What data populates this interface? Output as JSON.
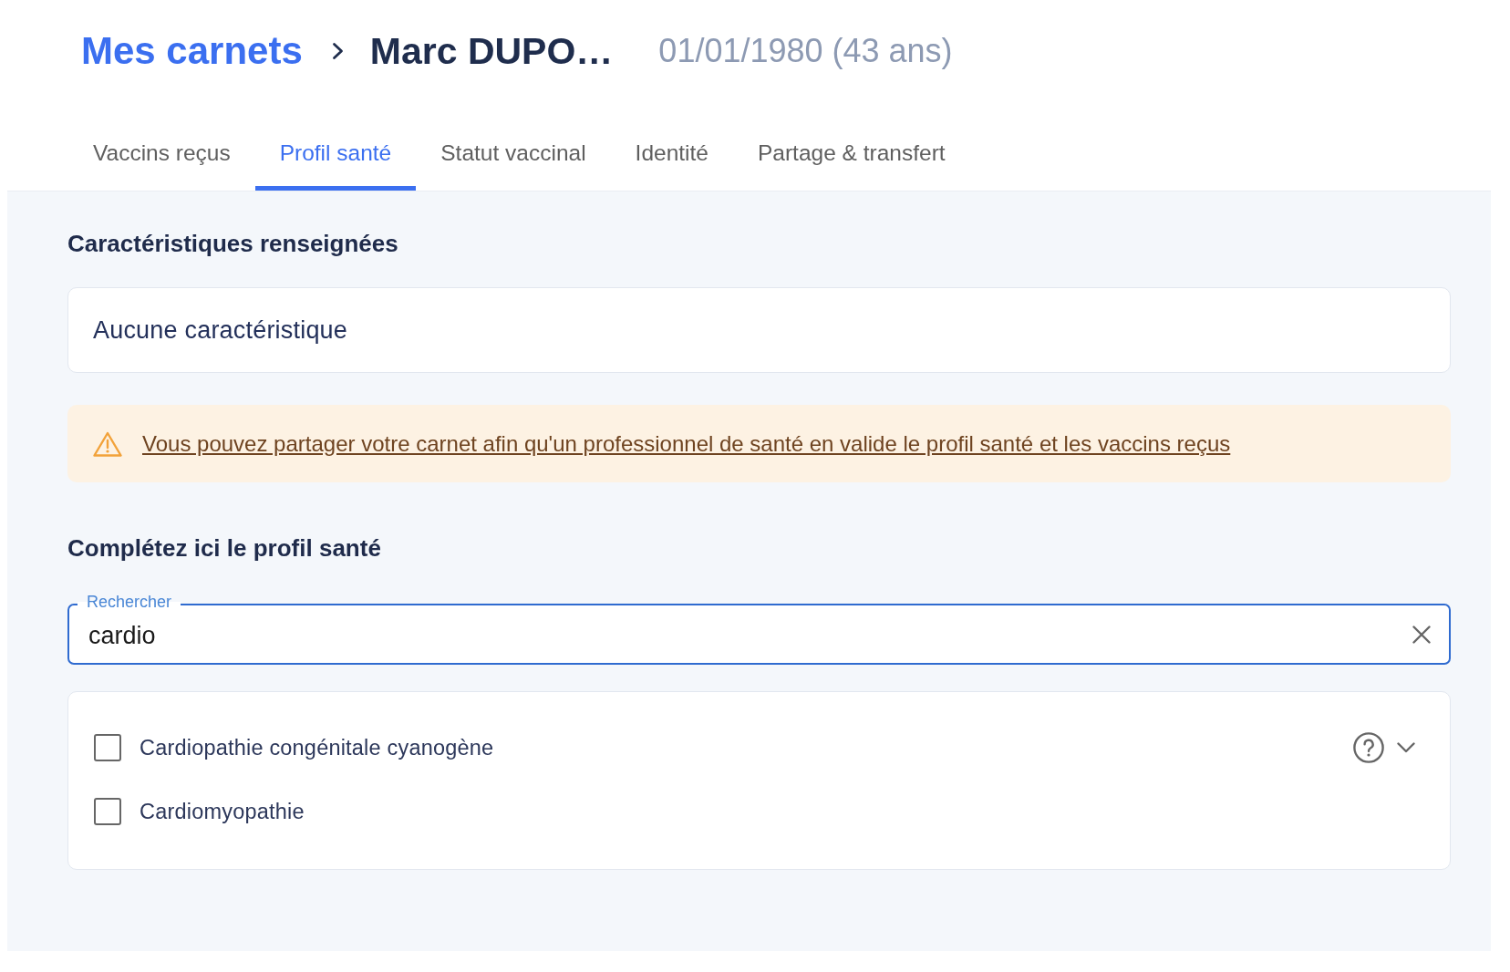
{
  "breadcrumb": {
    "parent": "Mes carnets",
    "current": "Marc DUPO…"
  },
  "birth_info": "01/01/1980 (43 ans)",
  "tabs": [
    {
      "label": "Vaccins reçus",
      "selected": false
    },
    {
      "label": "Profil santé",
      "selected": true
    },
    {
      "label": "Statut vaccinal",
      "selected": false
    },
    {
      "label": "Identité",
      "selected": false
    },
    {
      "label": "Partage & transfert",
      "selected": false
    }
  ],
  "characteristics": {
    "heading": "Caractéristiques renseignées",
    "empty_text": "Aucune caractéristique"
  },
  "notice": {
    "link": "Vous pouvez partager votre carnet afin qu'un professionnel de santé en valide le profil santé et les vaccins reçus"
  },
  "profile_form": {
    "heading": "Complétez ici le profil santé",
    "search": {
      "label": "Rechercher",
      "value": "cardio"
    },
    "results": [
      {
        "label": "Cardiopathie congénitale cyanogène",
        "checked": false,
        "help": true,
        "expandable": true
      },
      {
        "label": "Cardiomyopathie",
        "checked": false,
        "help": false,
        "expandable": false
      }
    ]
  }
}
